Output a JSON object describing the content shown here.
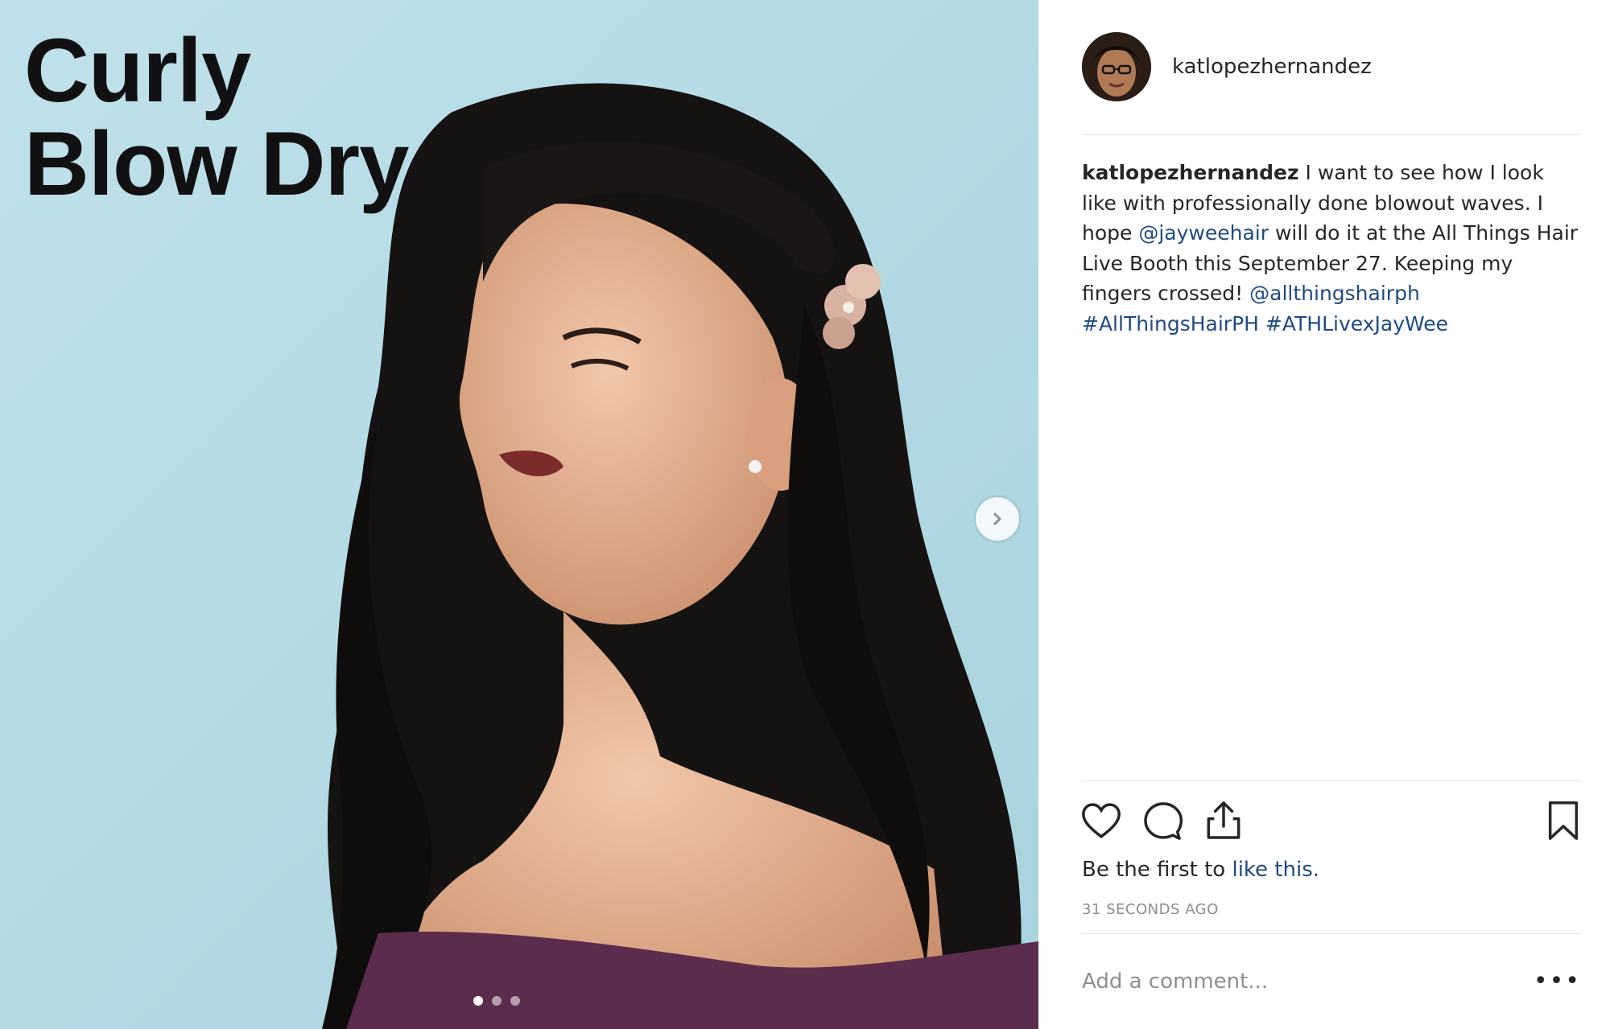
{
  "post": {
    "image": {
      "overlay_line1": "Curly",
      "overlay_line2": "Blow Dry",
      "next_icon": "chevron-right-icon",
      "carousel_count": 3,
      "carousel_active_index": 0
    },
    "author": {
      "username": "katlopezhernandez",
      "avatar_icon": "user-avatar"
    },
    "caption": {
      "username": "katlopezhernandez",
      "text1": " I want to see how I look like with professionally done blowout waves. I hope ",
      "mention1": "@jayweehair",
      "text2": " will do it at the All Things Hair Live Booth this September 27. Keeping my fingers crossed! ",
      "mention2": "@allthingshairph",
      "text3": " ",
      "hashtag1": "#AllThingsHairPH",
      "text4": " ",
      "hashtag2": "#ATHLivexJayWee"
    },
    "actions": {
      "like_icon": "heart-icon",
      "comment_icon": "comment-icon",
      "share_icon": "share-icon",
      "save_icon": "bookmark-icon"
    },
    "likes": {
      "prefix": "Be the first to ",
      "link": "like this."
    },
    "timestamp": "31 SECONDS AGO",
    "comment": {
      "placeholder": "Add a comment...",
      "more_label": "•••"
    }
  },
  "colors": {
    "background_blue": "#b9dde6",
    "link": "#1f4a82",
    "text": "#262626",
    "muted": "#8e8e8e"
  }
}
